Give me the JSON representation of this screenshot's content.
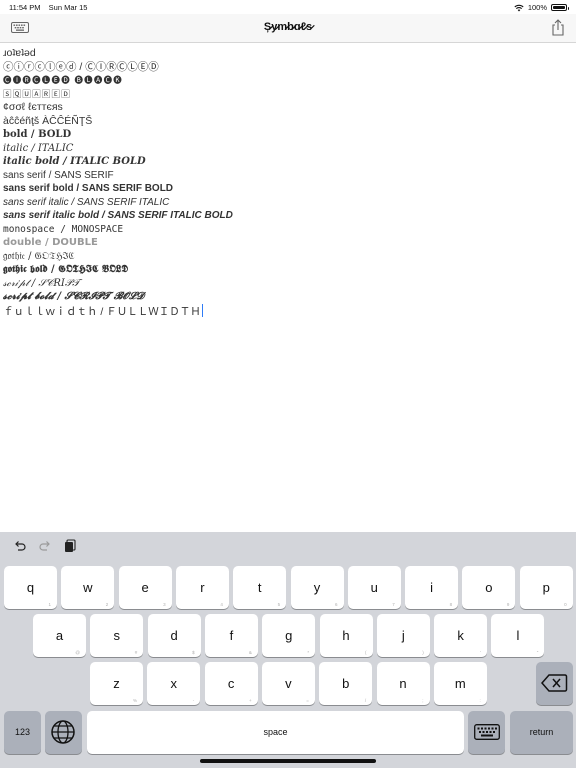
{
  "status_bar": {
    "time": "11:54 PM",
    "date": "Sun Mar 15",
    "battery": "100%"
  },
  "nav": {
    "title": "Ș̷y̷m̷b̷ɑ̷ℓ̷s̷"
  },
  "text_lines": [
    {
      "style": "l-normal",
      "text": "ɹoʇɐʇǝd"
    },
    {
      "style": "l-normal",
      "text": "ⓒⓘⓡⓒⓛⓔⓓ / ⒸⒾⓇⒸⓁⒺⒹ"
    },
    {
      "style": "l-caps",
      "text": "🅒🅘🅡🅒🅛🅔🅓 🅑🅛🅐🅒🅚"
    },
    {
      "style": "l-caps",
      "text": "🅂🅀🅄🄰🅁🄴🄳"
    },
    {
      "style": "l-normal",
      "text": "¢σσℓ ℓєттєяѕ"
    },
    {
      "style": "l-normal",
      "text": "àĉĉéñţš ÀĈĈÉÑŢŠ"
    },
    {
      "style": "l-bold",
      "text": "bold / BOLD"
    },
    {
      "style": "l-italic",
      "text": "italic / ITALIC"
    },
    {
      "style": "l-italicbold",
      "text": "italic bold / ITALIC BOLD"
    },
    {
      "style": "l-sans",
      "text": "sans serif / SANS SERIF"
    },
    {
      "style": "l-sansbold",
      "text": "sans serif bold / SANS SERIF BOLD"
    },
    {
      "style": "l-sansitalic",
      "text": "sans serif italic / SANS SERIF ITALIC"
    },
    {
      "style": "l-sansitalicbold",
      "text": "sans serif italic bold / SANS SERIF ITALIC BOLD"
    },
    {
      "style": "l-mono",
      "text": "monospace / MONOSPACE"
    },
    {
      "style": "l-double",
      "text": "double / DOUBLE"
    },
    {
      "style": "l-gothic",
      "text": "𝔤𝔬𝔱𝔥𝔦𝔠 / 𝔊𝔒𝔗ℌℑℭ"
    },
    {
      "style": "l-gothicbold",
      "text": "𝖌𝖔𝖙𝖍𝖎𝖈 𝖇𝖔𝖑𝖉 / 𝕲𝕺𝕿𝕳𝕴𝕮 𝕭𝕺𝕷𝕯"
    },
    {
      "style": "l-script",
      "text": "𝓈𝒸𝓇𝒾𝓅𝓉 / 𝒮𝒞𝑅𝐼𝒫𝒯"
    },
    {
      "style": "l-scriptbold",
      "text": "𝓼𝓬𝓻𝓲𝓹𝓽 𝓫𝓸𝓵𝓭 / 𝓢𝓒𝓡𝓘𝓟𝓣 𝓑𝓞𝓛𝓓"
    },
    {
      "style": "l-fullwidth",
      "text": "ｆｕｌｌｗｉｄｔｈ / ＦＵＬＬＷＩＤＴＨ"
    }
  ],
  "keyboard": {
    "toolbar": {
      "undo": "undo-icon",
      "redo": "redo-icon",
      "paste": "clipboard-icon"
    },
    "row1": [
      {
        "l": "q",
        "s": "1"
      },
      {
        "l": "w",
        "s": "2"
      },
      {
        "l": "e",
        "s": "3"
      },
      {
        "l": "r",
        "s": "4"
      },
      {
        "l": "t",
        "s": "5"
      },
      {
        "l": "y",
        "s": "6"
      },
      {
        "l": "u",
        "s": "7"
      },
      {
        "l": "i",
        "s": "8"
      },
      {
        "l": "o",
        "s": "9"
      },
      {
        "l": "p",
        "s": "0"
      }
    ],
    "row2": [
      {
        "l": "a",
        "s": "@"
      },
      {
        "l": "s",
        "s": "#"
      },
      {
        "l": "d",
        "s": "$"
      },
      {
        "l": "f",
        "s": "&"
      },
      {
        "l": "g",
        "s": "*"
      },
      {
        "l": "h",
        "s": "("
      },
      {
        "l": "j",
        "s": ")"
      },
      {
        "l": "k",
        "s": "'"
      },
      {
        "l": "l",
        "s": "\""
      }
    ],
    "row3": [
      {
        "l": "z",
        "s": "%"
      },
      {
        "l": "x",
        "s": "-"
      },
      {
        "l": "c",
        "s": "+"
      },
      {
        "l": "v",
        "s": "="
      },
      {
        "l": "b",
        "s": "/"
      },
      {
        "l": "n",
        "s": ";"
      },
      {
        "l": "m",
        "s": ":"
      }
    ],
    "numbers_label": "123",
    "space_label": "space",
    "return_label": "return"
  },
  "colors": {
    "cursor": "#2f7cf6",
    "keyboard_bg": "#d3d5da",
    "dark_key": "#abb0ba"
  }
}
